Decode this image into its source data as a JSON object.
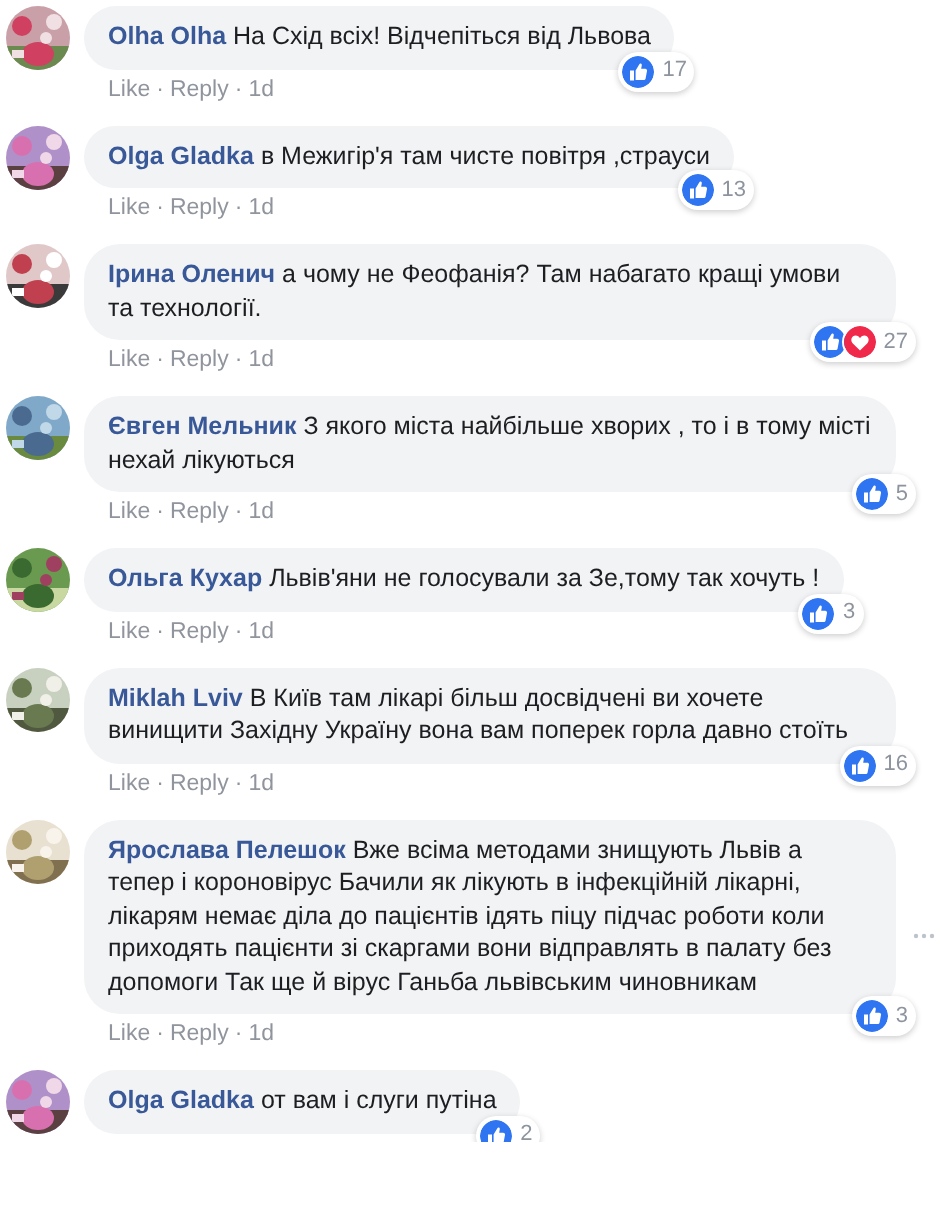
{
  "comments": [
    {
      "avatar": {
        "kind": "picture"
      },
      "author": "Olha Olha",
      "text": "На Схід всіх! Відчепіться від Львова",
      "reactions": [
        {
          "kind": "like"
        }
      ],
      "reaction_count": "17",
      "actions": [
        {
          "text": "Like",
          "separator": "·"
        },
        {
          "text": "Reply",
          "separator": "·"
        },
        {
          "text": "1d"
        }
      ],
      "menu_visible": false
    },
    {
      "avatar": {
        "kind": "picture"
      },
      "author": "Olga Gladka",
      "text": "в Межигір'я там чисте повітря ,страуси",
      "reactions": [
        {
          "kind": "like"
        }
      ],
      "reaction_count": "13",
      "actions": [
        {
          "text": "Like",
          "separator": "·"
        },
        {
          "text": "Reply",
          "separator": "·"
        },
        {
          "text": "1d"
        }
      ],
      "menu_visible": false
    },
    {
      "avatar": {
        "kind": "picture"
      },
      "author": "Ірина Оленич",
      "text": "а чому не Феофанія? Там набагато кращі умови та технології.",
      "reactions": [
        {
          "kind": "like"
        },
        {
          "kind": "love"
        }
      ],
      "reaction_count": "27",
      "actions": [
        {
          "text": "Like",
          "separator": "·"
        },
        {
          "text": "Reply",
          "separator": "·"
        },
        {
          "text": "1d"
        }
      ],
      "menu_visible": false
    },
    {
      "avatar": {
        "kind": "picture"
      },
      "author": "Євген Мельник",
      "text": "З якого міста найбільше хворих , то і в тому місті нехай лікуються",
      "reactions": [
        {
          "kind": "like"
        }
      ],
      "reaction_count": "5",
      "actions": [
        {
          "text": "Like",
          "separator": "·"
        },
        {
          "text": "Reply",
          "separator": "·"
        },
        {
          "text": "1d"
        }
      ],
      "menu_visible": false
    },
    {
      "avatar": {
        "kind": "picture"
      },
      "author": "Ольга Кухар",
      "text": "Львів'яни не голосували за Зе,тому так хочуть !",
      "reactions": [
        {
          "kind": "like"
        }
      ],
      "reaction_count": "3",
      "actions": [
        {
          "text": "Like",
          "separator": "·"
        },
        {
          "text": "Reply",
          "separator": "·"
        },
        {
          "text": "1d"
        }
      ],
      "menu_visible": false
    },
    {
      "avatar": {
        "kind": "picture"
      },
      "author": "Miklah Lviv",
      "text": "В Київ там лікарі більш досвідчені ви хочете винищити Західну Україну вона вам поперек горла давно стоїть",
      "reactions": [
        {
          "kind": "like"
        }
      ],
      "reaction_count": "16",
      "actions": [
        {
          "text": "Like",
          "separator": "·"
        },
        {
          "text": "Reply",
          "separator": "·"
        },
        {
          "text": "1d"
        }
      ],
      "menu_visible": false
    },
    {
      "avatar": {
        "kind": "picture"
      },
      "author": "Ярослава Пелешок",
      "text": "Вже всіма методами знищують Львів а тепер і короновірус Бачили як лікують в інфекційній лікарні, лікарям немає діла до пацієнтів ідять піцу підчас роботи коли приходять пацієнти зі скаргами вони відправлять в палату без допомоги Так ще й вірус Ганьба львівським чиновникам",
      "reactions": [
        {
          "kind": "like"
        }
      ],
      "reaction_count": "3",
      "actions": [
        {
          "text": "Like",
          "separator": "·"
        },
        {
          "text": "Reply",
          "separator": "·"
        },
        {
          "text": "1d"
        }
      ],
      "menu_visible": true
    },
    {
      "avatar": {
        "kind": "picture"
      },
      "author": "Olga Gladka",
      "text": "от вам і слуги путіна",
      "reactions": [
        {
          "kind": "like"
        }
      ],
      "reaction_count": "2",
      "menu_visible": false
    }
  ]
}
